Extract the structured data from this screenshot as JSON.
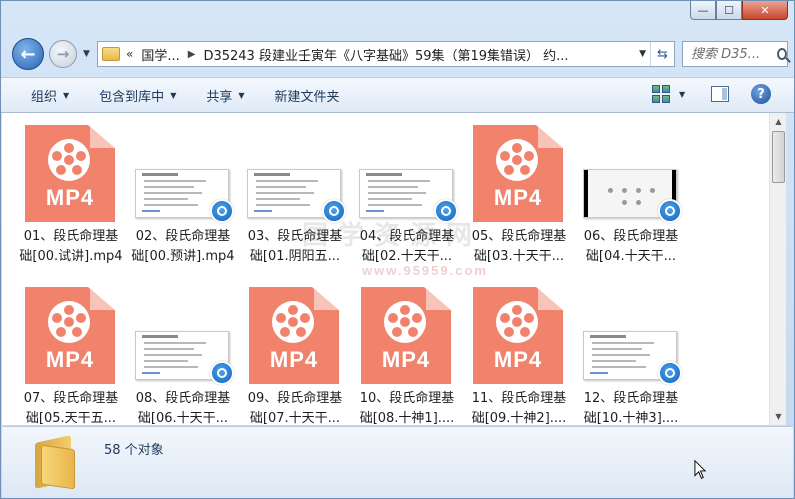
{
  "window": {
    "buttons": {
      "minimize": "—",
      "maximize": "☐",
      "close": "✕"
    }
  },
  "nav": {
    "back_icon": "back-arrow-icon",
    "forward_icon": "forward-arrow-icon",
    "breadcrumb_prefix": "«",
    "breadcrumb": [
      "国学...",
      "D35243 段建业壬寅年《八字基础》59集（第19集错误） 约..."
    ],
    "search_placeholder": "搜索 D35..."
  },
  "toolbar": {
    "items": [
      "组织",
      "包含到库中",
      "共享",
      "新建文件夹"
    ]
  },
  "files": [
    {
      "line1": "01、段氏命理基",
      "line2": "础[00.试讲].mp4",
      "thumb": "mp4"
    },
    {
      "line1": "02、段氏命理基",
      "line2": "础[00.预讲].mp4",
      "thumb": "slide"
    },
    {
      "line1": "03、段氏命理基",
      "line2": "础[01.阴阳五...",
      "thumb": "slide"
    },
    {
      "line1": "04、段氏命理基",
      "line2": "础[02.十天干...",
      "thumb": "slide"
    },
    {
      "line1": "05、段氏命理基",
      "line2": "础[03.十天干...",
      "thumb": "mp4"
    },
    {
      "line1": "06、段氏命理基",
      "line2": "础[04.十天干...",
      "thumb": "dark-slide"
    },
    {
      "line1": "07、段氏命理基",
      "line2": "础[05.天干五...",
      "thumb": "mp4"
    },
    {
      "line1": "08、段氏命理基",
      "line2": "础[06.十天干...",
      "thumb": "slide"
    },
    {
      "line1": "09、段氏命理基",
      "line2": "础[07.十天干...",
      "thumb": "mp4"
    },
    {
      "line1": "10、段氏命理基",
      "line2": "础[08.十神1]....",
      "thumb": "mp4"
    },
    {
      "line1": "11、段氏命理基",
      "line2": "础[09.十神2]....",
      "thumb": "mp4"
    },
    {
      "line1": "12、段氏命理基",
      "line2": "础[10.十神3]....",
      "thumb": "slide"
    }
  ],
  "mp4_label": "MP4",
  "watermark": {
    "text": "国学资源网",
    "url": "www.95959.com"
  },
  "status": {
    "count": "58 个对象"
  }
}
